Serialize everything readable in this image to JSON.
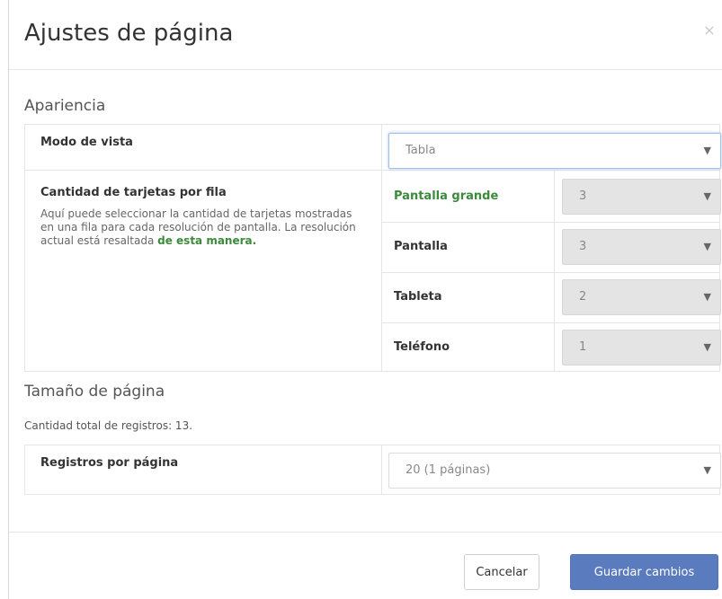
{
  "dialog": {
    "title": "Ajustes de página",
    "close_symbol": "×"
  },
  "appearance": {
    "section_title": "Apariencia",
    "view_mode": {
      "label": "Modo de vista",
      "value": "Tabla"
    },
    "cards_per_row": {
      "label": "Cantidad de tarjetas por fila",
      "help_text": "Aquí puede seleccionar la cantidad de tarjetas mostradas en una fila para cada resolución de pantalla. La resolución actual está resaltada",
      "help_highlight": "de esta manera.",
      "resolutions": [
        {
          "label": "Pantalla grande",
          "value": "3",
          "highlighted": true
        },
        {
          "label": "Pantalla",
          "value": "3",
          "highlighted": false
        },
        {
          "label": "Tableta",
          "value": "2",
          "highlighted": false
        },
        {
          "label": "Teléfono",
          "value": "1",
          "highlighted": false
        }
      ]
    }
  },
  "page_size": {
    "section_title": "Tamaño de página",
    "total_records_text": "Cantidad total de registros: 13.",
    "records_per_page": {
      "label": "Registros por página",
      "value": "20 (1 páginas)"
    }
  },
  "footer": {
    "cancel_label": "Cancelar",
    "save_label": "Guardar cambios"
  },
  "icons": {
    "chevron": "chevron-down-icon",
    "close": "close-icon"
  },
  "colors": {
    "highlight_green": "#3c8a3c",
    "primary_button": "#5b7bbf"
  }
}
